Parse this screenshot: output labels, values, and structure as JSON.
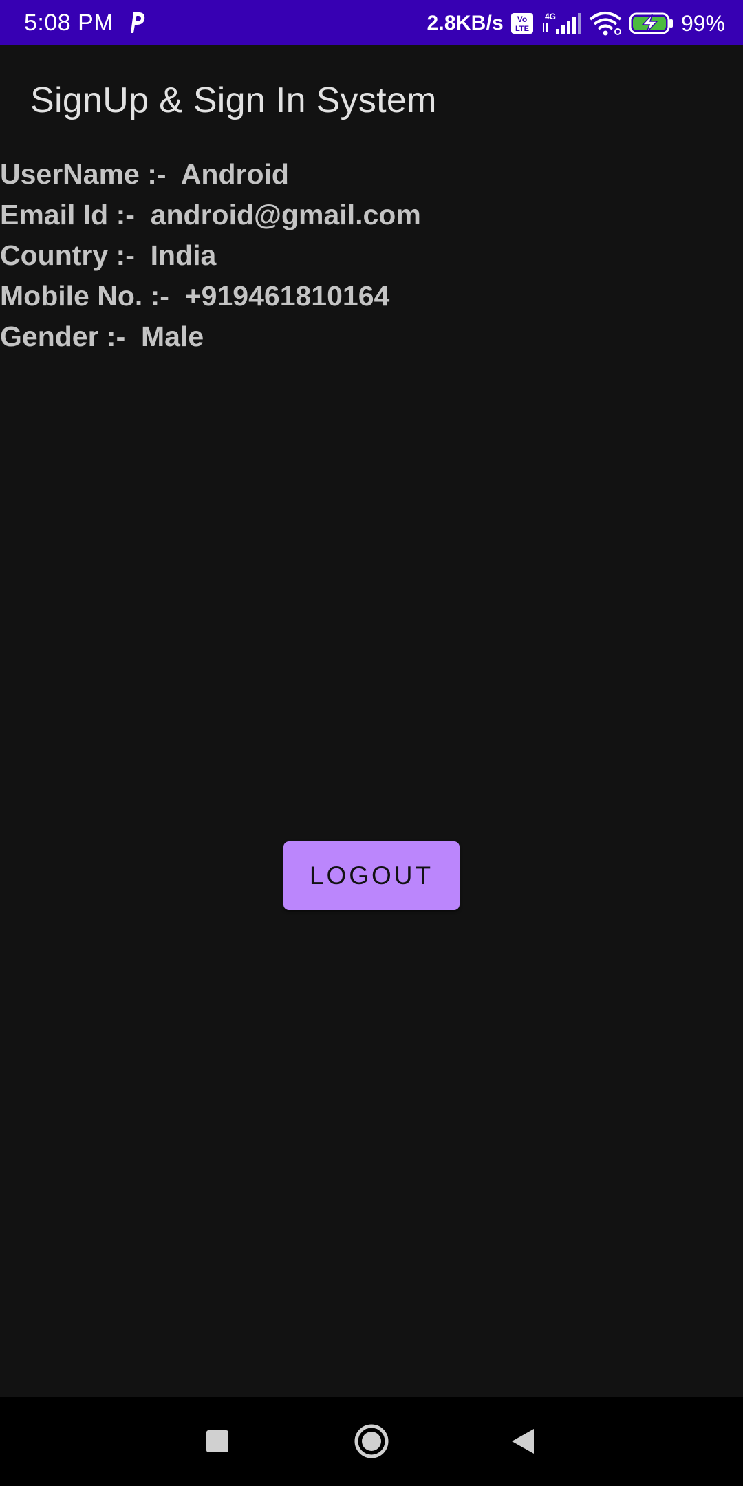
{
  "status_bar": {
    "time": "5:08 PM",
    "network_speed": "2.8KB/s",
    "network_type": "4G",
    "volte": "Vo LTE",
    "battery_percent": "99%",
    "background_color": "#3700b3",
    "icons": [
      "parking-notification-icon",
      "volte-icon",
      "signal-icon",
      "wifi-icon",
      "battery-charging-icon"
    ]
  },
  "app_bar": {
    "title": "SignUp & Sign In System"
  },
  "profile": {
    "rows": [
      {
        "text": "UserName :-  Android"
      },
      {
        "text": "Email Id :-  android@gmail.com"
      },
      {
        "text": "Country :-  India"
      },
      {
        "text": "Mobile No. :-  +919461810164"
      },
      {
        "text": "Gender :-  Male"
      }
    ]
  },
  "actions": {
    "logout_label": "LOGOUT",
    "accent_color": "#bb86fc"
  },
  "nav_bar": {
    "icons": [
      "recents-square-icon",
      "home-circle-icon",
      "back-triangle-icon"
    ]
  }
}
